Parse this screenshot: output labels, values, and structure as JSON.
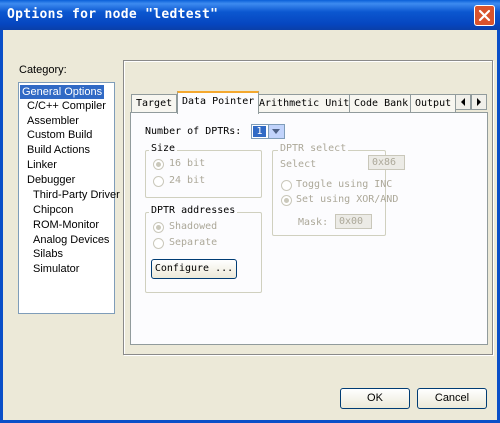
{
  "window": {
    "title": "Options for node \"ledtest\""
  },
  "category": {
    "label": "Category:",
    "items": [
      {
        "label": "General Options",
        "selected": true
      },
      {
        "label": "C/C++ Compiler"
      },
      {
        "label": "Assembler"
      },
      {
        "label": "Custom Build"
      },
      {
        "label": "Build Actions"
      },
      {
        "label": "Linker"
      },
      {
        "label": "Debugger"
      },
      {
        "label": "Third-Party Driver"
      },
      {
        "label": "Chipcon"
      },
      {
        "label": "ROM-Monitor"
      },
      {
        "label": "Analog Devices"
      },
      {
        "label": "Silabs"
      },
      {
        "label": "Simulator"
      }
    ]
  },
  "tabs": [
    {
      "label": "Target"
    },
    {
      "label": "Data Pointer",
      "active": true
    },
    {
      "label": "Arithmetic Unit"
    },
    {
      "label": "Code Bank"
    },
    {
      "label": "Output"
    }
  ],
  "data_pointer": {
    "num_dptrs_label": "Number of DPTRs:",
    "num_dptrs_value": "1",
    "size": {
      "label": "Size",
      "opt_16": "16 bit",
      "opt_24": "24 bit",
      "selected": "16 bit"
    },
    "dptr_addresses": {
      "label": "DPTR addresses",
      "opt_shadowed": "Shadowed",
      "opt_separate": "Separate",
      "selected": "Shadowed",
      "configure_button": "Configure ..."
    },
    "dptr_select": {
      "label": "DPTR select",
      "select_label": "Select",
      "select_value": "0x86",
      "opt_toggle": "Toggle using INC",
      "opt_xor": "Set using XOR/AND",
      "selected": "Set using XOR/AND",
      "mask_label": "Mask:",
      "mask_value": "0x00"
    }
  },
  "buttons": {
    "ok": "OK",
    "cancel": "Cancel"
  },
  "colors": {
    "titlebar": "#0a56d0",
    "selection": "#316ac5",
    "tab_highlight": "#f4a82e",
    "disabled_text": "#aca899"
  }
}
